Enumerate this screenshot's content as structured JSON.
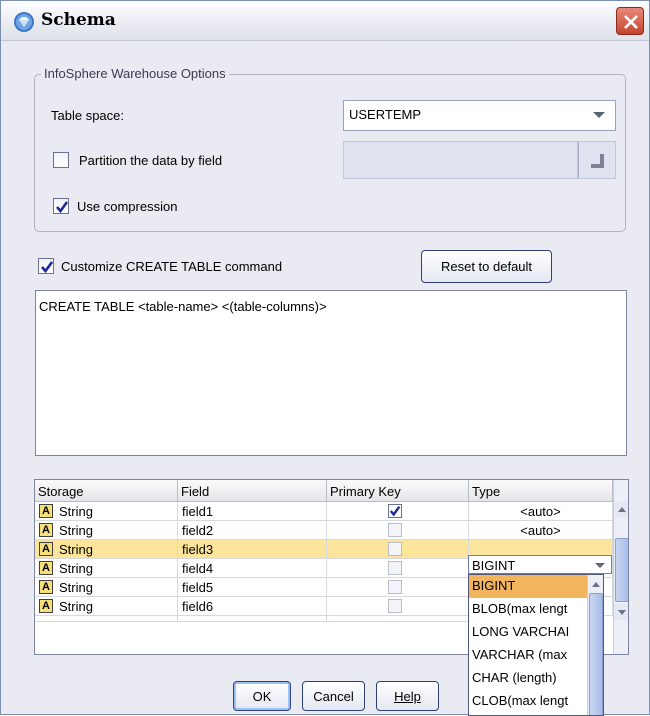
{
  "window": {
    "title": "Schema",
    "accent": "#7b8fb0"
  },
  "options_group": {
    "legend": "InfoSphere Warehouse Options",
    "table_space_label": "Table space:",
    "table_space_value": "USERTEMP",
    "partition_label": "Partition the data by field",
    "partition_checked": false,
    "partition_field_value": "",
    "compression_label": "Use compression",
    "compression_checked": true
  },
  "customize": {
    "label": "Customize CREATE TABLE command",
    "checked": true,
    "reset_label": "Reset to default",
    "command_text": "CREATE TABLE <table-name> <(table-columns)>"
  },
  "grid": {
    "headers": [
      "Storage",
      "Field",
      "Primary Key",
      "Type"
    ],
    "rows": [
      {
        "storage": "String",
        "field": "field1",
        "primary_key": true,
        "type": "<auto>"
      },
      {
        "storage": "String",
        "field": "field2",
        "primary_key": false,
        "type": "<auto>"
      },
      {
        "storage": "String",
        "field": "field3",
        "primary_key": false,
        "type": "BIGINT"
      },
      {
        "storage": "String",
        "field": "field4",
        "primary_key": false,
        "type": ""
      },
      {
        "storage": "String",
        "field": "field5",
        "primary_key": false,
        "type": ""
      },
      {
        "storage": "String",
        "field": "field6",
        "primary_key": false,
        "type": ""
      }
    ],
    "storage_icon_letter": "A",
    "selected_row_color": "#fbe59a"
  },
  "type_dropdown": {
    "current": "BIGINT",
    "options": [
      "BIGINT",
      "BLOB(max lengt",
      "LONG VARCHAI",
      "VARCHAR (max",
      "CHAR (length)",
      "CLOB(max lengt"
    ],
    "highlight_color": "#f2b45c"
  },
  "footer": {
    "ok_label": "OK",
    "cancel_label": "Cancel",
    "help_label": "Help"
  }
}
